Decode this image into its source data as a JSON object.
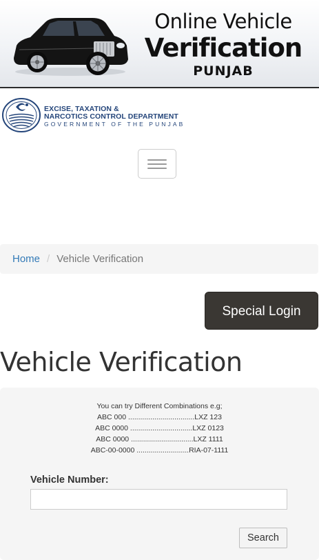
{
  "banner": {
    "line1": "Online Vehicle",
    "line2": "Verification",
    "line3": "PUNJAB"
  },
  "department": {
    "line1": "EXCISE, TAXATION &",
    "line2": "NARCOTICS CONTROL DEPARTMENT",
    "line3": "GOVERNMENT OF THE PUNJAB"
  },
  "breadcrumb": {
    "home": "Home",
    "separator": "/",
    "current": "Vehicle Verification"
  },
  "special_login": "Special Login",
  "page_title": "Vehicle Verification",
  "hints": {
    "intro": "You can try Different Combinations e.g;",
    "examples": [
      "ABC 000 .................................LXZ 123",
      "ABC 0000 ...............................LXZ 0123",
      "ABC 0000 ...............................LXZ 1111",
      "ABC-00-0000 ..........................RIA-07-1111"
    ]
  },
  "form": {
    "label": "Vehicle Number:",
    "value": "",
    "search_label": "Search"
  },
  "colors": {
    "link": "#337ab7",
    "dept_blue": "#24457a",
    "special_btn": "#3a3733"
  }
}
